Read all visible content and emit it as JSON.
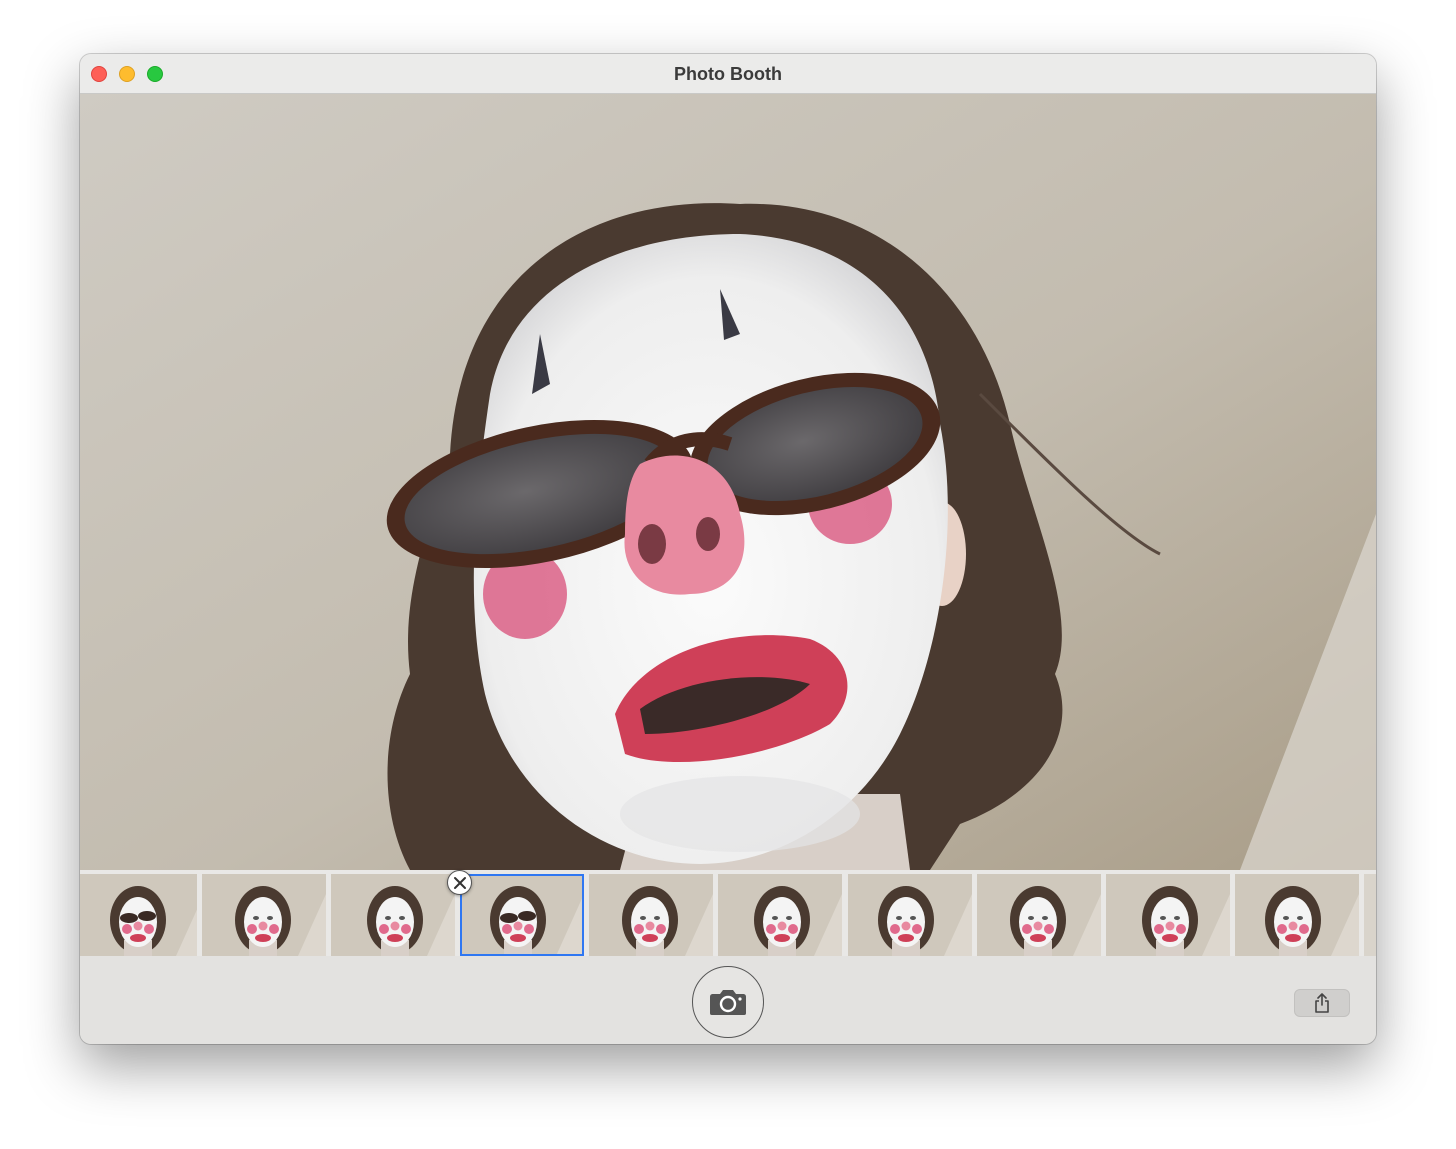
{
  "window": {
    "title": "Photo Booth",
    "controls": {
      "close": "#fe5f57",
      "minimize": "#febc2e",
      "zoom": "#28c840"
    }
  },
  "preview": {
    "description_icon": "live-camera-preview"
  },
  "filmstrip": {
    "thumbnail_count": 10,
    "selected_index": 3,
    "selected_outline_color": "#2f77f2",
    "delete_icon": "close-x-icon"
  },
  "toolbar": {
    "shutter_icon": "camera-icon",
    "share_icon": "share-icon"
  }
}
